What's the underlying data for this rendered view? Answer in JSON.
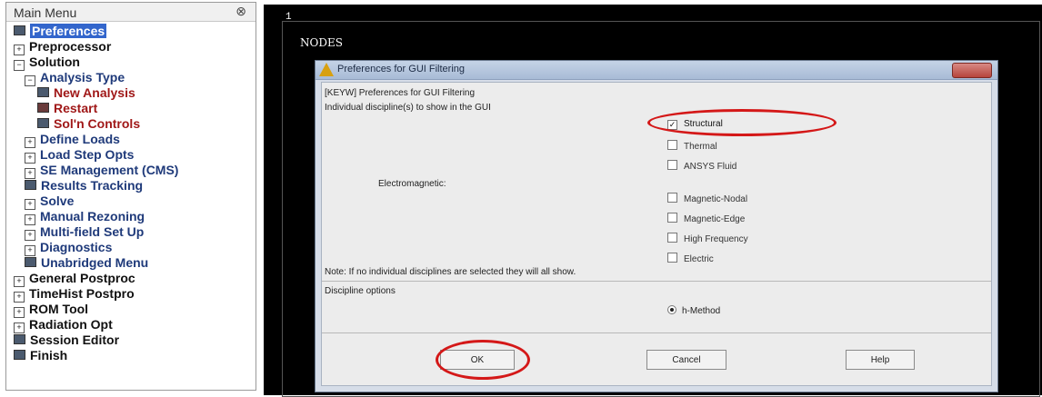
{
  "main_menu": {
    "title": "Main Menu",
    "collapse_glyph": "⊗",
    "items": [
      {
        "label": "Preferences",
        "icon": "leaf-icon"
      },
      {
        "label": "Preprocessor",
        "icon": "expand-icon"
      },
      {
        "label": "Solution",
        "icon": "collapse-icon"
      },
      {
        "label": "Analysis Type",
        "icon": "collapse-icon"
      },
      {
        "label": "New Analysis",
        "icon": "leaf-icon"
      },
      {
        "label": "Restart",
        "icon": "leaf-icon"
      },
      {
        "label": "Sol'n Controls",
        "icon": "leaf-icon"
      },
      {
        "label": "Define Loads",
        "icon": "expand-icon"
      },
      {
        "label": "Load Step Opts",
        "icon": "expand-icon"
      },
      {
        "label": "SE Management (CMS)",
        "icon": "expand-icon"
      },
      {
        "label": "Results Tracking",
        "icon": "leaf-icon"
      },
      {
        "label": "Solve",
        "icon": "expand-icon"
      },
      {
        "label": "Manual Rezoning",
        "icon": "expand-icon"
      },
      {
        "label": "Multi-field Set Up",
        "icon": "expand-icon"
      },
      {
        "label": "Diagnostics",
        "icon": "expand-icon"
      },
      {
        "label": "Unabridged Menu",
        "icon": "leaf-icon"
      },
      {
        "label": "General Postproc",
        "icon": "expand-icon"
      },
      {
        "label": "TimeHist Postpro",
        "icon": "expand-icon"
      },
      {
        "label": "ROM Tool",
        "icon": "expand-icon"
      },
      {
        "label": "Radiation Opt",
        "icon": "expand-icon"
      },
      {
        "label": "Session Editor",
        "icon": "leaf-icon"
      },
      {
        "label": "Finish",
        "icon": "leaf-icon"
      }
    ]
  },
  "graphics": {
    "window_number": "1",
    "label": "NODES"
  },
  "dialog": {
    "title": "Preferences for GUI Filtering",
    "header": "[KEYW] Preferences for GUI Filtering",
    "subheader": "Individual discipline(s) to show in the GUI",
    "electromagnetic_label": "Electromagnetic:",
    "options": [
      {
        "label": "Structural",
        "checked": true
      },
      {
        "label": "Thermal",
        "checked": false
      },
      {
        "label": "ANSYS Fluid",
        "checked": false
      },
      {
        "label": "Magnetic-Nodal",
        "checked": false
      },
      {
        "label": "Magnetic-Edge",
        "checked": false
      },
      {
        "label": "High Frequency",
        "checked": false
      },
      {
        "label": "Electric",
        "checked": false
      }
    ],
    "note": "Note: If no individual disciplines are selected they will all show.",
    "discipline_options_label": "Discipline options",
    "method_label": "h-Method",
    "buttons": {
      "ok": "OK",
      "cancel": "Cancel",
      "help": "Help"
    }
  },
  "colors": {
    "highlight_ring": "#d41818",
    "menu_selected": "#3366cc"
  }
}
